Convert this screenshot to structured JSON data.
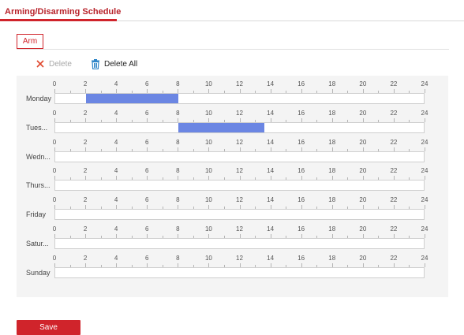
{
  "tabs": {
    "active_label": "Arming/Disarming Schedule"
  },
  "schedule_type_tab": {
    "label": "Arm"
  },
  "toolbar": {
    "delete_label": "Delete",
    "delete_all_label": "Delete All",
    "delete_icon": "close-icon",
    "delete_all_icon": "trash-icon",
    "delete_icon_color": "#e0492f",
    "delete_all_icon_color": "#2f86c8"
  },
  "hour_ticks": [
    "0",
    "2",
    "4",
    "6",
    "8",
    "10",
    "12",
    "14",
    "16",
    "18",
    "20",
    "22",
    "24"
  ],
  "days": [
    {
      "label": "Monday",
      "segments": [
        {
          "start": 2,
          "end": 8
        }
      ]
    },
    {
      "label": "Tues...",
      "segments": [
        {
          "start": 8,
          "end": 13.6
        }
      ]
    },
    {
      "label": "Wedn...",
      "segments": []
    },
    {
      "label": "Thurs...",
      "segments": []
    },
    {
      "label": "Friday",
      "segments": []
    },
    {
      "label": "Satur...",
      "segments": []
    },
    {
      "label": "Sunday",
      "segments": []
    }
  ],
  "colors": {
    "accent": "#d0242b",
    "segment": "#6b86e3"
  },
  "footer": {
    "save_label": "Save"
  }
}
